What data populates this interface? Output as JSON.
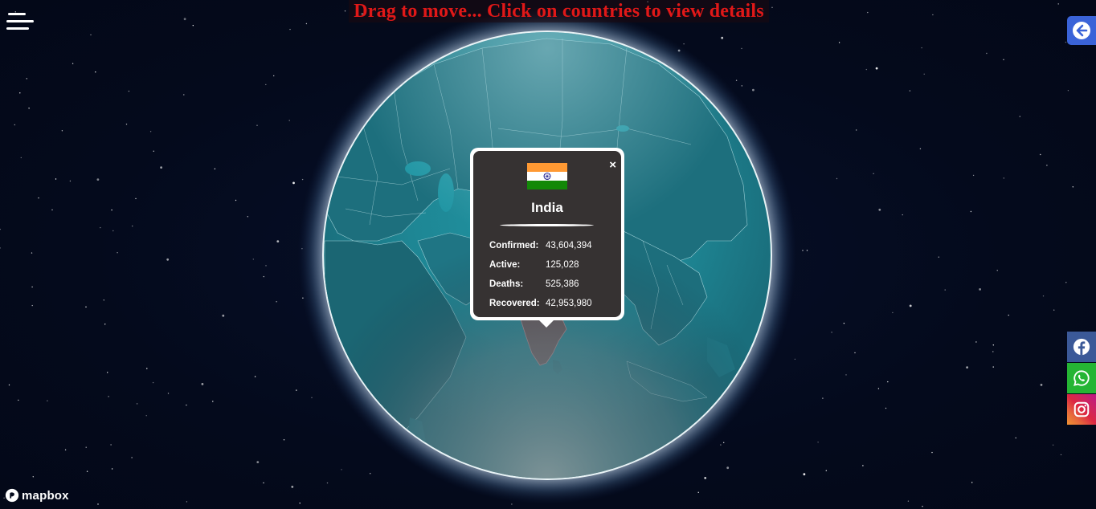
{
  "banner": {
    "text": "Drag to move... Click on countries to view details"
  },
  "popup": {
    "country": "India",
    "close_label": "×",
    "stats": [
      {
        "label": "Confirmed:",
        "value": "43,604,394"
      },
      {
        "label": "Active:",
        "value": "125,028"
      },
      {
        "label": "Deaths:",
        "value": "525,386"
      },
      {
        "label": "Recovered:",
        "value": "42,953,980"
      }
    ]
  },
  "attribution": {
    "logo_text": "mapbox"
  },
  "icons": {
    "menu": "hamburger-menu-icon",
    "back": "arrow-left-circle-icon",
    "facebook": "facebook-icon",
    "whatsapp": "whatsapp-icon",
    "instagram": "instagram-icon",
    "flag": "india-flag-icon",
    "mapbox": "mapbox-icon"
  },
  "colors": {
    "background": "#050b1d",
    "banner_text": "#e01818",
    "globe_ocean": "#1c8a98",
    "popup_bg": "#363232",
    "back_button": "#3a63d8",
    "facebook": "#3b5998",
    "whatsapp": "#25b534"
  }
}
